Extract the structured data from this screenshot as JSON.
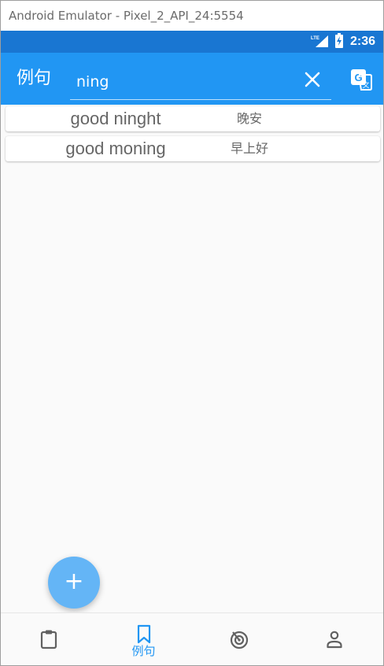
{
  "window": {
    "title": "Android Emulator - Pixel_2_API_24:5554"
  },
  "status_bar": {
    "network": "LTE",
    "time": "2:36"
  },
  "app_bar": {
    "title": "例句",
    "search_value": "ning",
    "clear_icon": "close-icon",
    "translate_icon": "translate-icon"
  },
  "sentences": [
    {
      "en": "good ninght",
      "zh": "晚安"
    },
    {
      "en": "good moning",
      "zh": "早上好"
    }
  ],
  "fab": {
    "label": "+"
  },
  "bottom_nav": {
    "items": [
      {
        "icon": "clipboard-icon",
        "label": "",
        "active": false
      },
      {
        "icon": "bookmark-icon",
        "label": "例句",
        "active": true
      },
      {
        "icon": "radar-icon",
        "label": "",
        "active": false
      },
      {
        "icon": "person-icon",
        "label": "",
        "active": false
      }
    ]
  },
  "colors": {
    "status_bar": "#1976d2",
    "app_bar": "#2196f3",
    "fab": "#64b5f6",
    "active_nav": "#2196f3",
    "inactive_nav": "#616161"
  }
}
